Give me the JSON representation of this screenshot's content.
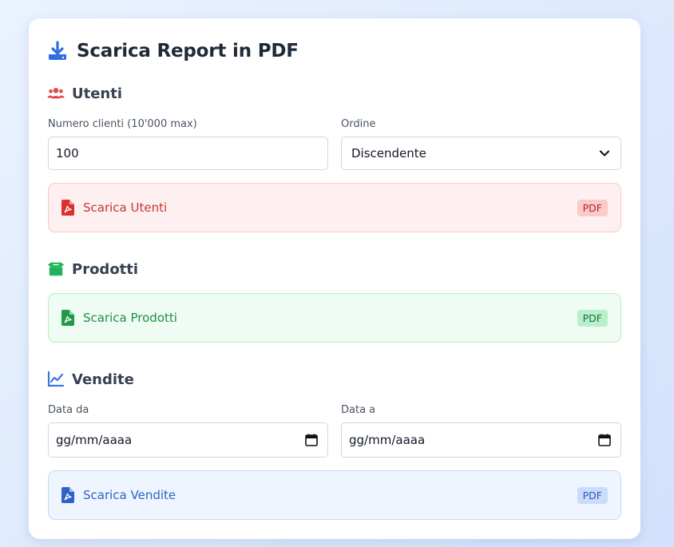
{
  "header": {
    "title": "Scarica Report in PDF",
    "icon": "download-icon"
  },
  "users": {
    "title": "Utenti",
    "icon": "users-icon",
    "count_label": "Numero clienti (10'000 max)",
    "count_value": "100",
    "order_label": "Ordine",
    "order_value": "Discendente",
    "download_label": "Scarica Utenti",
    "badge": "PDF"
  },
  "products": {
    "title": "Prodotti",
    "icon": "box-icon",
    "download_label": "Scarica Prodotti",
    "badge": "PDF"
  },
  "sales": {
    "title": "Vendite",
    "icon": "line-chart-icon",
    "date_from_label": "Data da",
    "date_from_value": "gg/mm/aaaa",
    "date_to_label": "Data a",
    "date_to_value": "gg/mm/aaaa",
    "download_label": "Scarica Vendite",
    "badge": "PDF"
  },
  "colors": {
    "primary": "#2f6fe0",
    "users_accent": "#e04a4a",
    "products_accent": "#22b35a",
    "sales_accent": "#3b76dd"
  }
}
